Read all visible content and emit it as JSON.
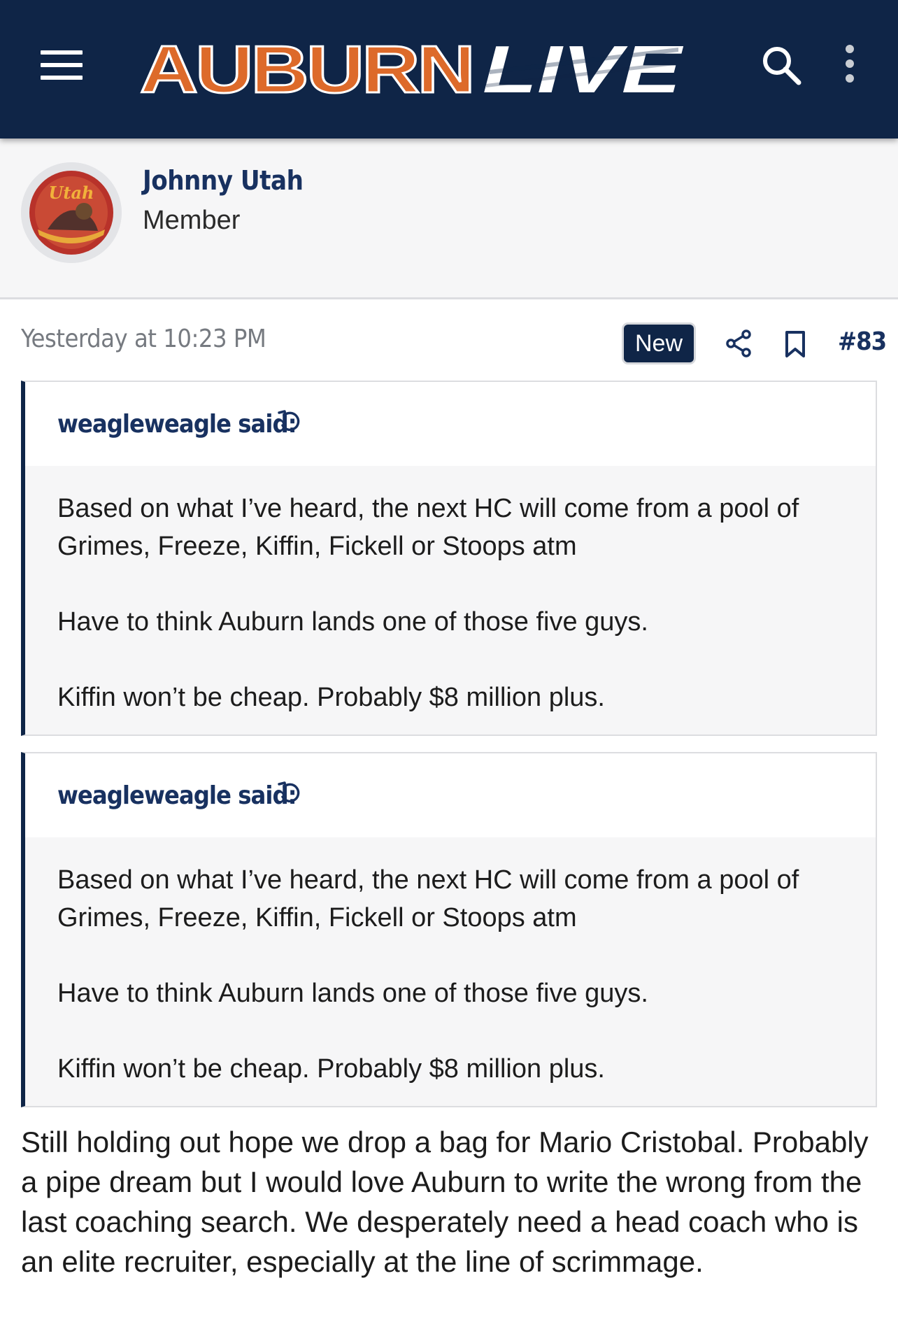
{
  "header": {
    "logo_primary": "AUBURN",
    "logo_secondary": "LIVE",
    "colors": {
      "bar": "#0f2547",
      "logo_orange": "#dd6a2a",
      "logo_white": "#ffffff"
    },
    "icons": [
      "menu-icon",
      "search-icon",
      "more-vertical-icon"
    ]
  },
  "author": {
    "name": "Johnny Utah",
    "role": "Member",
    "avatar_text": "Utah"
  },
  "post": {
    "timestamp": "Yesterday at 10:23 PM",
    "badge": "New",
    "number": "#83",
    "icons": [
      "share-icon",
      "bookmark-icon"
    ]
  },
  "quotes": [
    {
      "author": "weagleweagle said:",
      "paragraphs": [
        "Based on what I’ve heard, the next HC will come from a pool of Grimes, Freeze, Kiffin, Fickell or Stoops atm",
        "Have to think Auburn lands one of those five guys.",
        "Kiffin won’t be cheap. Probably $8 million plus."
      ]
    },
    {
      "author": "weagleweagle said:",
      "paragraphs": [
        "Based on what I’ve heard, the next HC will come from a pool of Grimes, Freeze, Kiffin, Fickell or Stoops atm",
        "Have to think Auburn lands one of those five guys.",
        "Kiffin won’t be cheap. Probably $8 million plus."
      ]
    }
  ],
  "body": "Still holding out hope we drop a bag for Mario Cristobal. Probably a pipe dream but I would love Auburn to write the wrong from the last coaching search. We desperately need a head coach who is an elite recruiter, especially at the line of scrimmage."
}
